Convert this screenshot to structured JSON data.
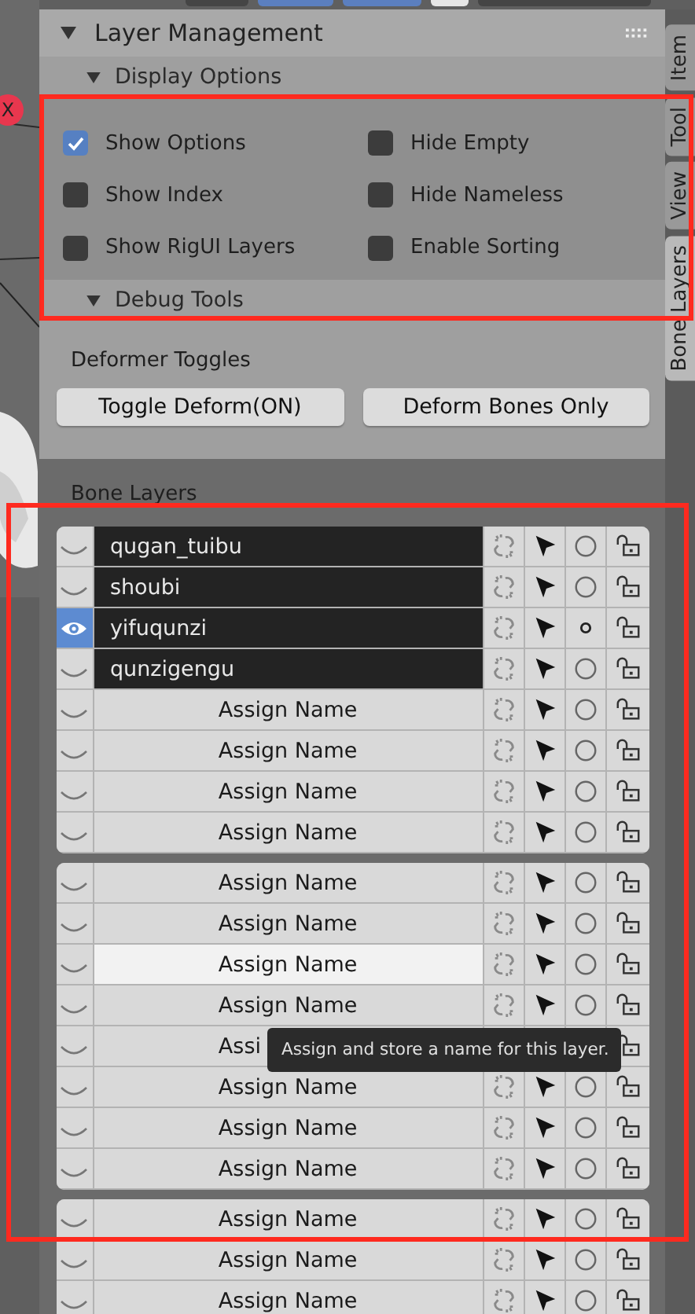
{
  "viewport": {
    "axis_label": "X"
  },
  "panel": {
    "title": "Layer Management",
    "display_options": {
      "title": "Display Options",
      "options": [
        {
          "label": "Show Options",
          "checked": true
        },
        {
          "label": "Hide Empty",
          "checked": false
        },
        {
          "label": "Show Index",
          "checked": false
        },
        {
          "label": "Hide Nameless",
          "checked": false
        },
        {
          "label": "Show RigUI Layers",
          "checked": false
        },
        {
          "label": "Enable Sorting",
          "checked": false
        }
      ]
    },
    "debug_tools": {
      "title": "Debug Tools"
    },
    "deformer": {
      "title": "Deformer Toggles",
      "buttons": [
        "Toggle Deform(ON)",
        "Deform Bones Only"
      ]
    },
    "bone_layers": {
      "title": "Bone Layers",
      "groups": [
        {
          "rows": [
            {
              "kind": "named",
              "name": "qugan_tuibu",
              "visible": false,
              "active": false
            },
            {
              "kind": "named",
              "name": "shoubi",
              "visible": false,
              "active": false
            },
            {
              "kind": "named",
              "name": "yifuqunzi",
              "visible": true,
              "active": true
            },
            {
              "kind": "named",
              "name": "qunzigengu",
              "visible": false,
              "active": false
            },
            {
              "kind": "unnamed",
              "label": "Assign Name",
              "visible": false,
              "active": false,
              "hovered": false
            },
            {
              "kind": "unnamed",
              "label": "Assign Name",
              "visible": false,
              "active": false,
              "hovered": false
            },
            {
              "kind": "unnamed",
              "label": "Assign Name",
              "visible": false,
              "active": false,
              "hovered": false
            },
            {
              "kind": "unnamed",
              "label": "Assign Name",
              "visible": false,
              "active": false,
              "hovered": false
            }
          ]
        },
        {
          "rows": [
            {
              "kind": "unnamed",
              "label": "Assign Name",
              "visible": false,
              "active": false,
              "hovered": false
            },
            {
              "kind": "unnamed",
              "label": "Assign Name",
              "visible": false,
              "active": false,
              "hovered": false
            },
            {
              "kind": "unnamed",
              "label": "Assign Name",
              "visible": false,
              "active": false,
              "hovered": true
            },
            {
              "kind": "unnamed",
              "label": "Assign Name",
              "visible": false,
              "active": false,
              "hovered": false
            },
            {
              "kind": "covered",
              "label": "Assi",
              "visible": false,
              "hovered": false
            },
            {
              "kind": "unnamed",
              "label": "Assign Name",
              "visible": false,
              "active": false,
              "hovered": false
            },
            {
              "kind": "unnamed",
              "label": "Assign Name",
              "visible": false,
              "active": false,
              "hovered": false
            },
            {
              "kind": "unnamed",
              "label": "Assign Name",
              "visible": false,
              "active": false,
              "hovered": false
            }
          ]
        },
        {
          "rows": [
            {
              "kind": "unnamed",
              "label": "Assign Name",
              "visible": false,
              "active": false,
              "hovered": false
            },
            {
              "kind": "unnamed",
              "label": "Assign Name",
              "visible": false,
              "active": false,
              "hovered": false
            },
            {
              "kind": "unnamed",
              "label": "Assign Name",
              "visible": false,
              "active": false,
              "hovered": false
            }
          ]
        }
      ]
    },
    "tooltip": "Assign and store a name for this layer."
  },
  "tabs": [
    {
      "label": "Item",
      "selected": false
    },
    {
      "label": "Tool",
      "selected": false
    },
    {
      "label": "View",
      "selected": false
    },
    {
      "label": "Bone Layers",
      "selected": true
    }
  ]
}
